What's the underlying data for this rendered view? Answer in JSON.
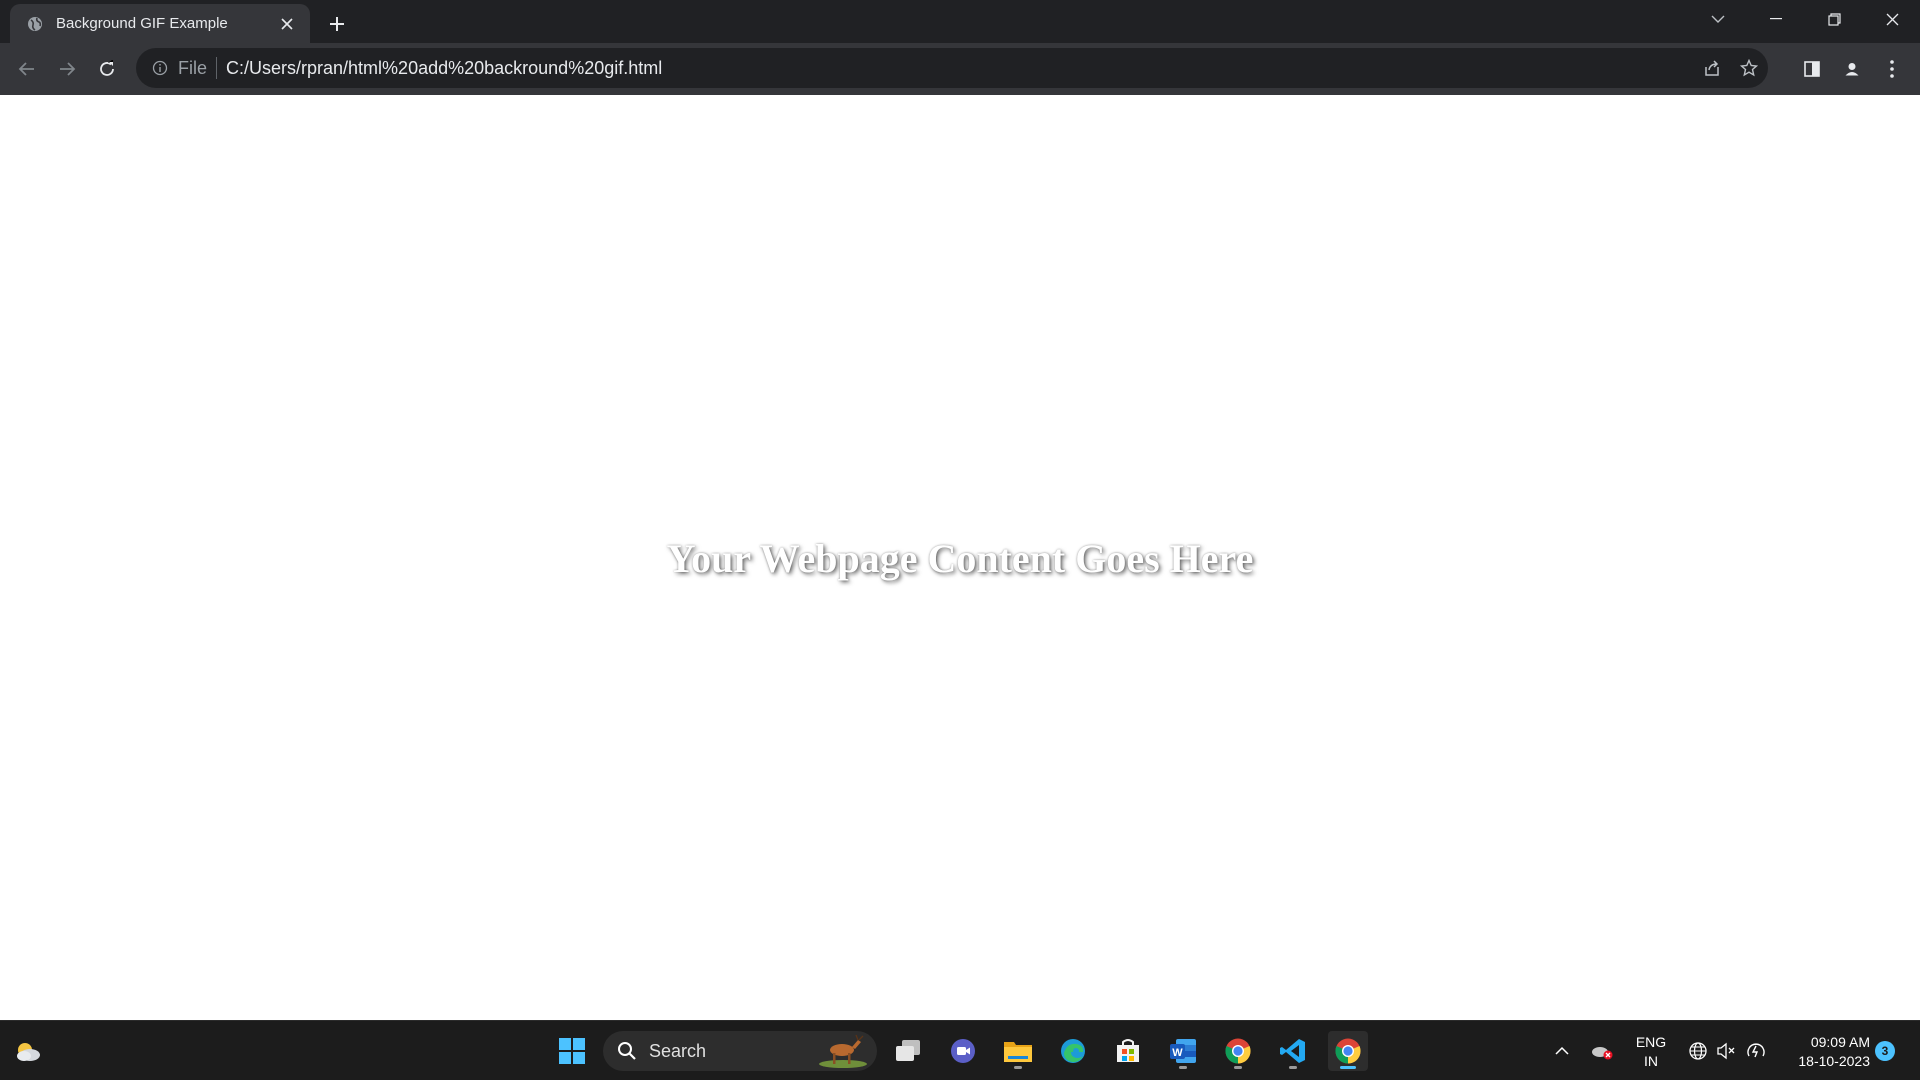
{
  "browser": {
    "tab": {
      "title": "Background GIF Example",
      "icon": "globe-icon"
    },
    "omnibox": {
      "scheme_label": "File",
      "url": "C:/Users/rpran/html%20add%20backround%20gif.html"
    }
  },
  "page": {
    "headline": "Your Webpage Content Goes Here"
  },
  "taskbar": {
    "search_label": "Search",
    "apps": [
      "start-icon",
      "task-view-icon",
      "teams-chat-icon",
      "file-explorer-icon",
      "edge-icon",
      "microsoft-store-icon",
      "word-icon",
      "chrome-icon",
      "vscode-icon",
      "chrome-icon"
    ],
    "tray": {
      "language_line1": "ENG",
      "language_line2": "IN",
      "time": "09:09 AM",
      "date": "18-10-2023",
      "notification_count": "3"
    }
  },
  "colors": {
    "titlebar": "#202124",
    "toolbar": "#35363a",
    "taskbar": "#1c1c1c",
    "accent": "#4cc2ff"
  }
}
